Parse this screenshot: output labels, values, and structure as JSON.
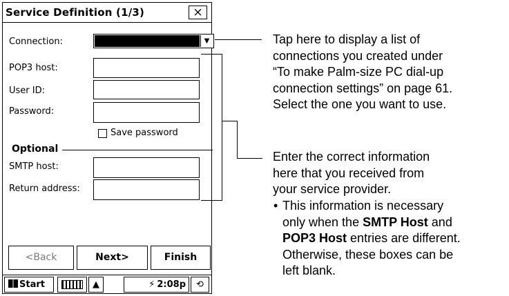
{
  "window": {
    "title": "Service Definition (1/3)",
    "close_glyph": "×"
  },
  "form": {
    "connection_label": "Connection:",
    "pop3_label": "POP3 host:",
    "userid_label": "User ID:",
    "password_label": "Password:",
    "save_password_label": "Save password",
    "optional_label": "Optional",
    "smtp_label": "SMTP host:",
    "return_label": "Return address:",
    "connection_value": "",
    "pop3_value": "",
    "userid_value": "",
    "password_value": "",
    "smtp_value": "",
    "return_value": "",
    "save_password_checked": false
  },
  "buttons": {
    "back": "<Back",
    "next": "Next>",
    "finish": "Finish"
  },
  "taskbar": {
    "start": "Start",
    "time": "2:08p"
  },
  "callouts": {
    "connection_lines": [
      "Tap here to display a list of",
      "connections you created under",
      "“To make Palm-size PC dial-up",
      "connection settings” on page 61.",
      "Select the one you want to use."
    ],
    "info_lines": [
      "Enter the correct information",
      "here that you received from",
      "your service provider."
    ],
    "bullet": "•",
    "bullet_pre1": "This information is necessary",
    "bullet_pre2": "only when the",
    "smtp_bold": "SMTP Host",
    "and_word": "and",
    "pop3_bold": "POP3 Host",
    "bullet_post1": "entries are different.",
    "bullet_post2": "Otherwise, these boxes can be",
    "bullet_post3": "left blank."
  },
  "icons": [
    "close-icon",
    "dropdown-arrow-icon",
    "checkbox-icon",
    "windows-logo-icon",
    "keyboard-icon",
    "up-arrow-icon",
    "connection-icon",
    "sync-icon"
  ]
}
